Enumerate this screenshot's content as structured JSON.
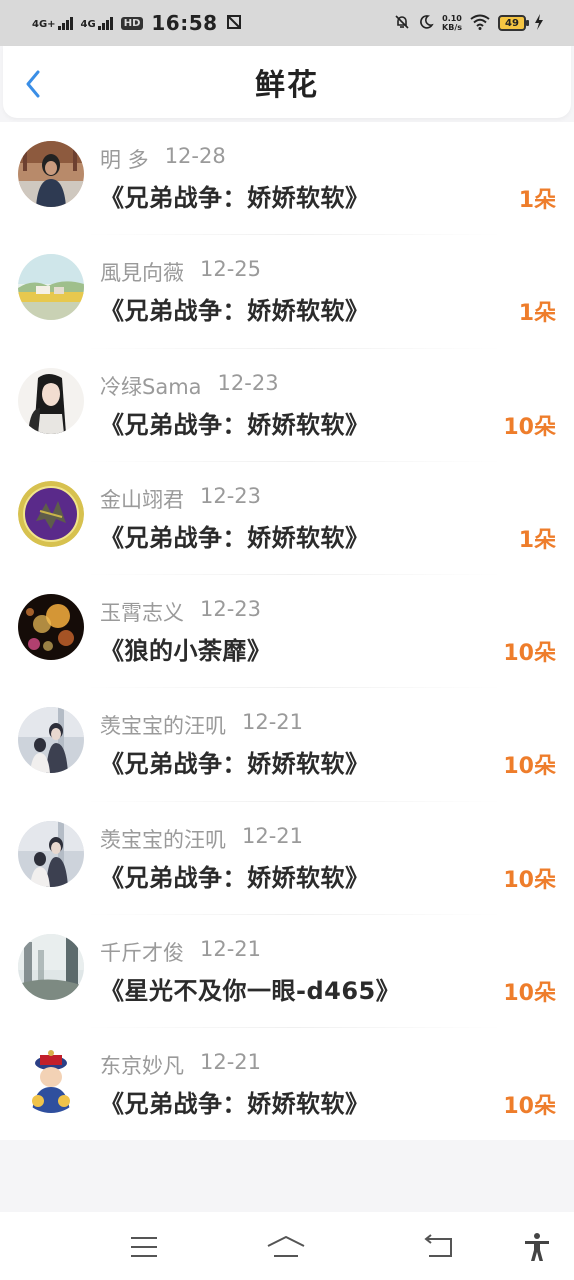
{
  "status_bar": {
    "sim1": "4G+",
    "sim2": "4G",
    "hd": "HD",
    "time": "16:58",
    "net_speed_value": "0.10",
    "net_speed_unit": "KB/s",
    "battery": "49"
  },
  "header": {
    "title": "鲜花"
  },
  "colors": {
    "accent": "#3a8ee6",
    "count": "#ee7d2b",
    "meta": "#9a9a9a"
  },
  "items": [
    {
      "user": "明 多",
      "date": "12-28",
      "book": "《兄弟战争：娇娇软软》",
      "count": "1朵",
      "avatar": "portrait-girl"
    },
    {
      "user": "風見向薇",
      "date": "12-25",
      "book": "《兄弟战争：娇娇软软》",
      "count": "1朵",
      "avatar": "landscape-field"
    },
    {
      "user": "冷绿Sama",
      "date": "12-23",
      "book": "《兄弟战争：娇娇软软》",
      "count": "10朵",
      "avatar": "anime-longhair"
    },
    {
      "user": "金山翊君",
      "date": "12-23",
      "book": "《兄弟战争：娇娇软软》",
      "count": "1朵",
      "avatar": "emblem-purple"
    },
    {
      "user": "玉霄志义",
      "date": "12-23",
      "book": "《狼的小荼靡》",
      "count": "10朵",
      "avatar": "bokeh-lights"
    },
    {
      "user": "羡宝宝的汪叽",
      "date": "12-21",
      "book": "《兄弟战争：娇娇软软》",
      "count": "10朵",
      "avatar": "couple-anime"
    },
    {
      "user": "羡宝宝的汪叽",
      "date": "12-21",
      "book": "《兄弟战争：娇娇软软》",
      "count": "10朵",
      "avatar": "couple-anime"
    },
    {
      "user": "千斤才俊",
      "date": "12-21",
      "book": "《星光不及你一眼-d465》",
      "count": "10朵",
      "avatar": "misty-forest"
    },
    {
      "user": "东京妙凡",
      "date": "12-21",
      "book": "《兄弟战争：娇娇软软》",
      "count": "10朵",
      "avatar": "cartoon-qing-official"
    }
  ]
}
